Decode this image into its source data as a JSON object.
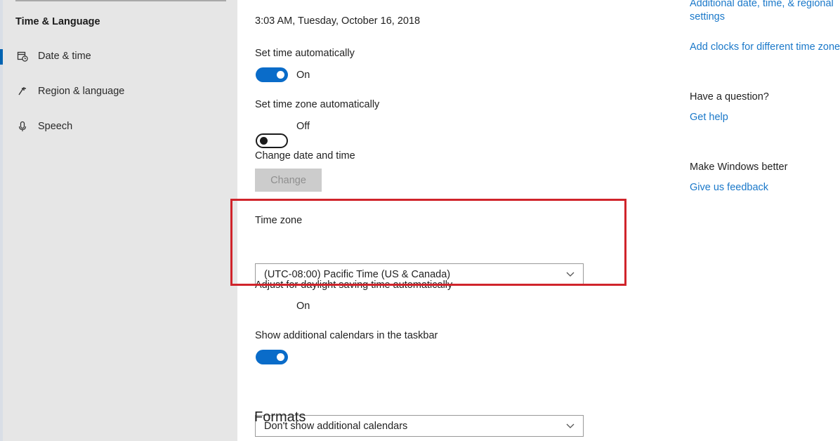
{
  "sidebar": {
    "section_title": "Time & Language",
    "items": [
      {
        "label": "Date & time",
        "icon": "calendar-clock-icon"
      },
      {
        "label": "Region & language",
        "icon": "region-icon"
      },
      {
        "label": "Speech",
        "icon": "microphone-icon"
      }
    ]
  },
  "main": {
    "current_datetime": "3:03 AM, Tuesday, October 16, 2018",
    "set_time_auto": {
      "label": "Set time automatically",
      "state": "On"
    },
    "set_tz_auto": {
      "label": "Set time zone automatically",
      "state": "Off"
    },
    "change_date": {
      "label": "Change date and time",
      "button": "Change"
    },
    "time_zone": {
      "label": "Time zone",
      "value": "(UTC-08:00) Pacific Time (US & Canada)"
    },
    "daylight": {
      "label": "Adjust for daylight saving time automatically",
      "state": "On"
    },
    "calendars": {
      "label": "Show additional calendars in the taskbar",
      "value": "Don't show additional calendars"
    },
    "formats_heading": "Formats"
  },
  "right": {
    "related_link_1_line1": "Additional date, time, & regional",
    "related_link_1_line2": "settings",
    "related_link_2": "Add clocks for different time zones",
    "question_title": "Have a question?",
    "get_help": "Get help",
    "feedback_title": "Make Windows better",
    "feedback_link": "Give us feedback"
  },
  "colors": {
    "accent": "#0a6cc9",
    "link": "#1a78c9",
    "highlight": "#d0242b"
  }
}
